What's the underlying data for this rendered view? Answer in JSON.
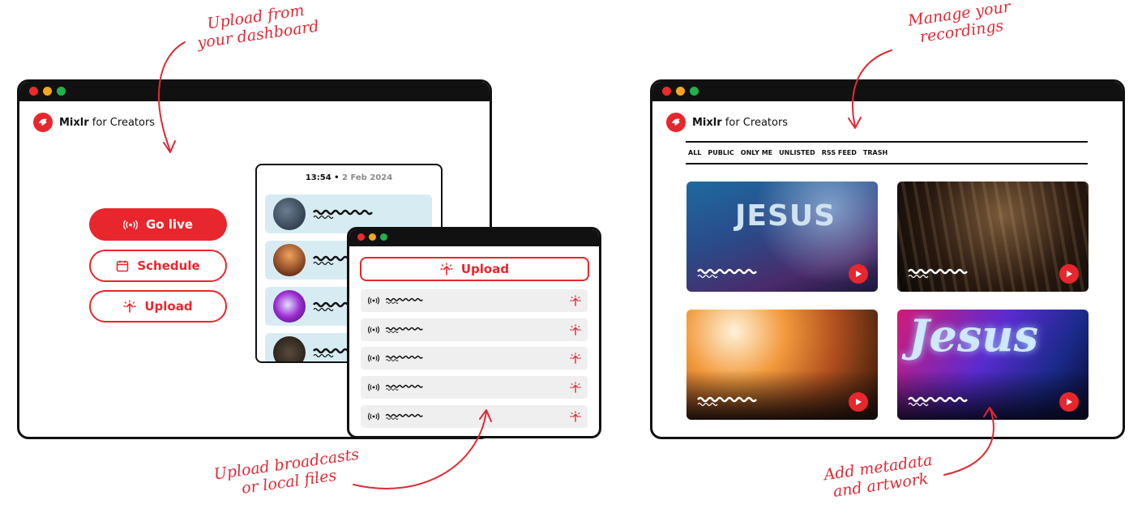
{
  "colors": {
    "brand_red": "#e8262d",
    "note_red": "#e02a35",
    "border": "#111111",
    "episode_bg": "#d7ecf2",
    "row_bg": "#efefef"
  },
  "annotations": {
    "upload_dashboard": [
      "Upload from",
      "your dashboard"
    ],
    "manage": [
      "Manage your",
      "recordings"
    ],
    "upload_broadcasts": [
      "Upload broadcasts",
      "or local files"
    ],
    "metadata": [
      "Add metadata",
      "and artwork"
    ]
  },
  "dashboard": {
    "logo_brand": "Mixlr",
    "logo_suffix": "for Creators",
    "buttons": {
      "go_live": "Go live",
      "schedule": "Schedule",
      "upload": "Upload"
    },
    "icons": {
      "go_live": "broadcast-icon",
      "schedule": "calendar-icon",
      "upload": "upload-icon"
    }
  },
  "episodes": {
    "time": "13:54",
    "separator": " • ",
    "date": "2 Feb 2024"
  },
  "upload_window": {
    "upload_button": "Upload",
    "rows": [
      {
        "icon": "broadcast-icon"
      },
      {
        "icon": "broadcast-icon"
      },
      {
        "icon": "broadcast-icon"
      },
      {
        "icon": "broadcast-icon"
      },
      {
        "icon": "broadcast-icon"
      }
    ]
  },
  "recordings": {
    "logo_brand": "Mixlr",
    "logo_suffix": "for Creators",
    "tabs": [
      "ALL",
      "PUBLIC",
      "ONLY ME",
      "UNLISTED",
      "RSS FEED",
      "TRASH"
    ],
    "cards": [
      {
        "artwork_text": "JESUS",
        "icon": "play-icon"
      },
      {
        "artwork_text": "",
        "icon": "play-icon"
      },
      {
        "artwork_text": "",
        "icon": "play-icon"
      },
      {
        "artwork_text": "Jesus",
        "icon": "play-icon"
      }
    ]
  }
}
